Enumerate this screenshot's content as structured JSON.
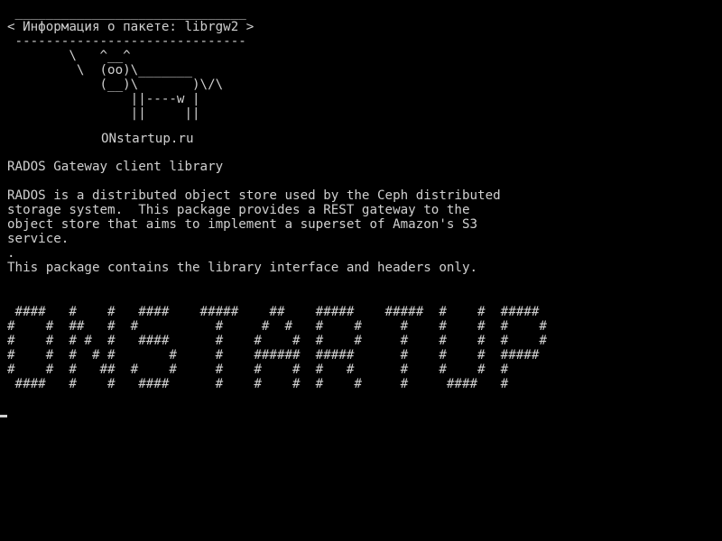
{
  "cowsay": {
    "border_top": " ______________________________",
    "header": "< Информация о пакете: librgw2 >",
    "border_bottom": " ------------------------------",
    "art": [
      "        \\   ^__^",
      "         \\  (oo)\\_______",
      "            (__)\\       )\\/\\",
      "                ||----w |",
      "                ||     ||"
    ]
  },
  "site": "ONstartup.ru",
  "description": {
    "summary": "RADOS Gateway client library",
    "body": [
      "RADOS is a distributed object store used by the Ceph distributed",
      "storage system.  This package provides a REST gateway to the",
      "object store that aims to implement a superset of Amazon's S3",
      "service.",
      ".",
      "This package contains the library interface and headers only."
    ]
  },
  "banner_text": [
    " ####   #    #   ####    #####    ##    #####    #####  #    #  #####",
    "#    #  ##   #  #          #     #  #   #    #     #    #    #  #    #",
    "#    #  # #  #   ####      #    #    #  #    #     #    #    #  #    #",
    "#    #  #  # #       #     #    ######  #####      #    #    #  #####",
    "#    #  #   ##  #    #     #    #    #  #   #      #    #    #  #",
    " ####   #    #   ####      #    #    #  #    #     #     ####   #"
  ]
}
